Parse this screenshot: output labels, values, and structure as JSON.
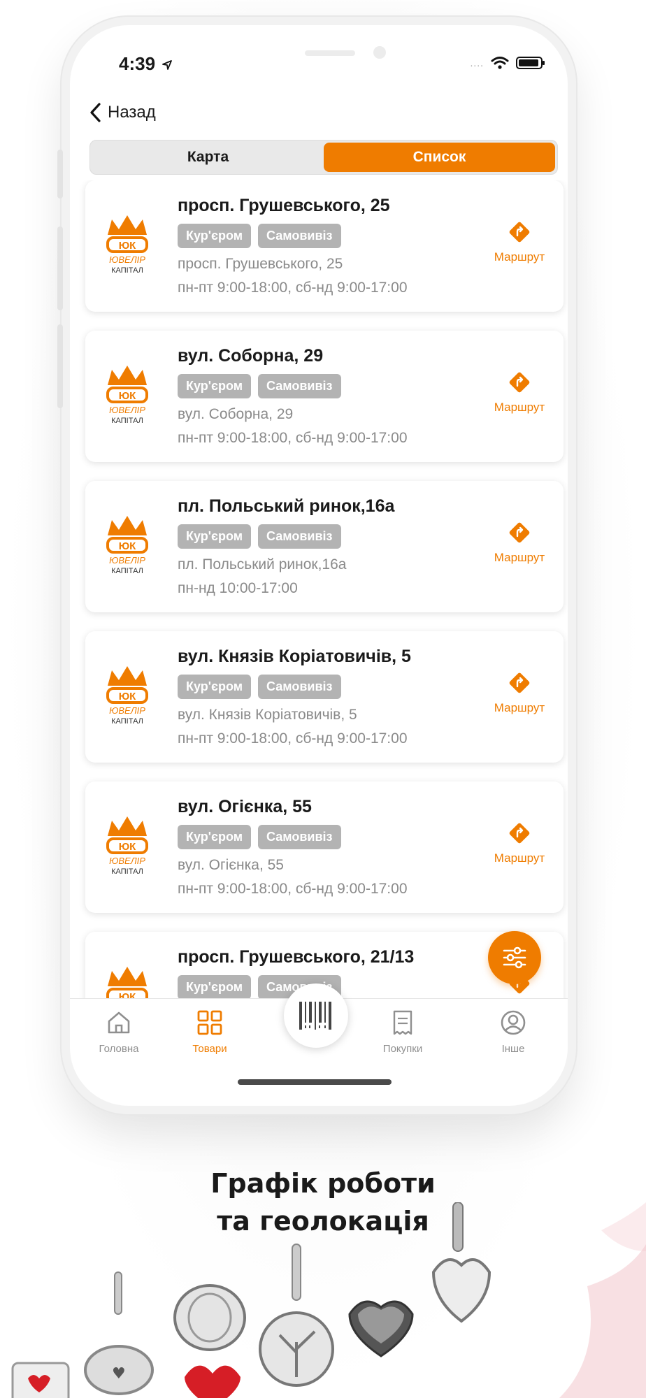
{
  "status": {
    "time": "4:39",
    "dots": "...."
  },
  "nav": {
    "back_label": "Назад"
  },
  "segmented": {
    "map_label": "Карта",
    "list_label": "Список",
    "active": "list"
  },
  "stores": [
    {
      "title": "просп. Грушевського, 25",
      "tags": [
        "Кур'єром",
        "Самовивіз"
      ],
      "address": "просп. Грушевського, 25",
      "hours": "пн-пт 9:00-18:00, сб-нд 9:00-17:00",
      "route_label": "Маршрут"
    },
    {
      "title": "вул. Соборна, 29",
      "tags": [
        "Кур'єром",
        "Самовивіз"
      ],
      "address": "вул. Соборна, 29",
      "hours": "пн-пт 9:00-18:00, сб-нд 9:00-17:00",
      "route_label": "Маршрут"
    },
    {
      "title": "пл. Польський ринок,16а",
      "tags": [
        "Кур'єром",
        "Самовивіз"
      ],
      "address": "пл. Польський ринок,16а",
      "hours": "пн-нд 10:00-17:00",
      "route_label": "Маршрут"
    },
    {
      "title": "вул. Князів Коріатовичів, 5",
      "tags": [
        "Кур'єром",
        "Самовивіз"
      ],
      "address": "вул. Князів Коріатовичів, 5",
      "hours": "пн-пт 9:00-18:00, сб-нд 9:00-17:00",
      "route_label": "Маршрут"
    },
    {
      "title": "вул. Огієнка, 55",
      "tags": [
        "Кур'єром",
        "Самовивіз"
      ],
      "address": "вул. Огієнка, 55",
      "hours": "пн-пт 9:00-18:00, сб-нд 9:00-17:00",
      "route_label": "Маршрут"
    },
    {
      "title": "просп. Грушевського, 21/13",
      "tags": [
        "Кур'єром",
        "Самовивіз"
      ],
      "address": "",
      "hours": "",
      "route_label": ""
    }
  ],
  "logo": {
    "brand_text": "ЮВЕЛІР КАПІТАЛ",
    "mark": "ЮК"
  },
  "tabbar": {
    "home": "Головна",
    "products": "Товари",
    "purchases": "Покупки",
    "other": "Інше",
    "active": "products"
  },
  "caption": {
    "line1": "Графік роботи",
    "line2": "та геолокація"
  },
  "colors": {
    "accent": "#ef7c00",
    "tag_bg": "#b3b3b3",
    "muted_text": "#8a8a8a"
  },
  "icons": [
    "location-arrow-icon",
    "wifi-icon",
    "battery-icon",
    "chevron-left-icon",
    "route-icon",
    "filter-icon",
    "home-icon",
    "grid-icon",
    "barcode-icon",
    "receipt-icon",
    "user-icon"
  ]
}
